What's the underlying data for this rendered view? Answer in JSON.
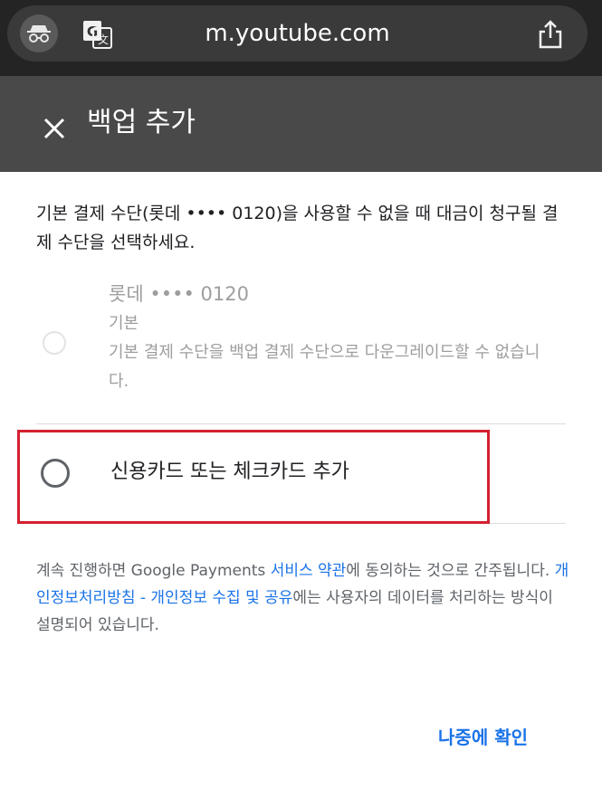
{
  "browser": {
    "url": "m.youtube.com",
    "icons": [
      "incognito-icon",
      "translate-icon",
      "share-icon"
    ]
  },
  "header": {
    "title": "백업 추가",
    "close_icon": "close-icon"
  },
  "description": "기본 결제 수단(롯데 •••• 0120)을 사용할 수 없을 때 대금이 청구될 결제 수단을 선택하세요.",
  "options": [
    {
      "name": "롯데 •••• 0120",
      "subtitle": "기본",
      "note": "기본 결제 수단을 백업 결제 수단으로 다운그레이드할 수 없습니다.",
      "disabled": true
    },
    {
      "label": "신용카드 또는 체크카드 추가",
      "disabled": false
    }
  ],
  "legal": {
    "part1": "계속 진행하면 Google Payments ",
    "link1": "서비스 약관",
    "part2": "에 동의하는 것으로 간주됩니다. ",
    "link2": "개인정보처리방침 - 개인정보 수집 및 공유",
    "part3": "에는 사용자의 데이터를 처리하는 방식이 설명되어 있습니다."
  },
  "later_button": "나중에 확인",
  "colors": {
    "link": "#1a73e8",
    "highlight_box": "#d32030",
    "header_bg": "#494949",
    "browser_bg": "#242424"
  }
}
